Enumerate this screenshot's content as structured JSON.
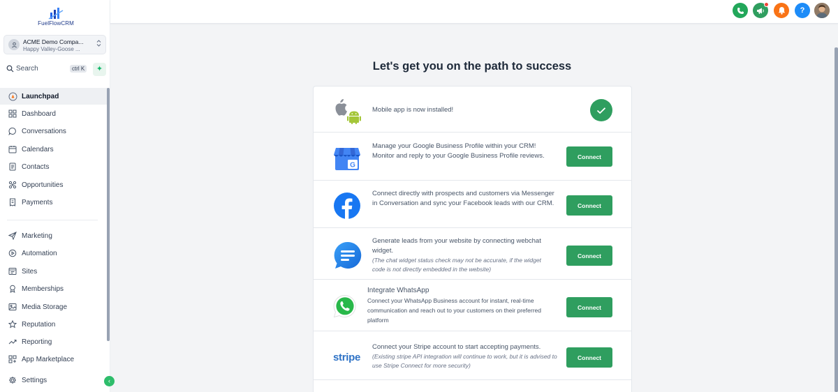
{
  "brand": {
    "name": "FuelFlowCRM",
    "color": "#1e3a8a"
  },
  "account": {
    "name": "ACME Demo Compa...",
    "location": "Happy Valley-Goose ..."
  },
  "search": {
    "label": "Search",
    "shortcut": "ctrl K"
  },
  "sidebar": {
    "items": [
      {
        "label": "Launchpad",
        "icon": "rocket-icon",
        "active": true
      },
      {
        "label": "Dashboard",
        "icon": "grid-icon"
      },
      {
        "label": "Conversations",
        "icon": "chat-bubble-icon"
      },
      {
        "label": "Calendars",
        "icon": "calendar-icon"
      },
      {
        "label": "Contacts",
        "icon": "contacts-book-icon"
      },
      {
        "label": "Opportunities",
        "icon": "pipeline-icon"
      },
      {
        "label": "Payments",
        "icon": "receipt-icon"
      },
      {
        "label": "Marketing",
        "icon": "paper-plane-icon"
      },
      {
        "label": "Automation",
        "icon": "automation-icon"
      },
      {
        "label": "Sites",
        "icon": "browser-window-icon"
      },
      {
        "label": "Memberships",
        "icon": "badge-icon"
      },
      {
        "label": "Media Storage",
        "icon": "image-icon"
      },
      {
        "label": "Reputation",
        "icon": "star-icon"
      },
      {
        "label": "Reporting",
        "icon": "trend-up-icon"
      },
      {
        "label": "App Marketplace",
        "icon": "apps-icon"
      },
      {
        "label": "Settings",
        "icon": "gear-icon"
      }
    ]
  },
  "topbar": {
    "icons": [
      "phone-icon",
      "megaphone-icon",
      "bell-icon",
      "help-icon",
      "user-avatar"
    ],
    "colors": {
      "phone": "#22a75a",
      "megaphone": "#2f9e5f",
      "bell": "#f97316",
      "help": "#1d8cf8"
    }
  },
  "main": {
    "heading": "Let's get you on the path to success",
    "connect_label": "Connect",
    "rows": [
      {
        "id": "mobile",
        "text": "Mobile app is now installed!",
        "status": "completed"
      },
      {
        "id": "gbp",
        "text": "Manage your Google Business Profile within your CRM! Monitor and reply to your Google Business Profile reviews."
      },
      {
        "id": "facebook",
        "text": "Connect directly with prospects and customers via Messenger in Conversation and sync your Facebook leads with our CRM."
      },
      {
        "id": "webchat",
        "text": "Generate leads from your website by connecting webchat widget.",
        "note": "(The chat widget status check may not be accurate, if the widget code is not directly embedded in the website)"
      },
      {
        "id": "whatsapp",
        "title": "Integrate WhatsApp",
        "text": "Connect your WhatsApp Business account for instant, real-time communication and reach out to your customers on their preferred platform"
      },
      {
        "id": "stripe",
        "logo_text": "stripe",
        "text": "Connect your Stripe account to start accepting payments.",
        "note": "(Existing stripe API integration will continue to work, but it is advised to use Stripe Connect for more security)"
      }
    ]
  },
  "accent": "#2f9e5f"
}
